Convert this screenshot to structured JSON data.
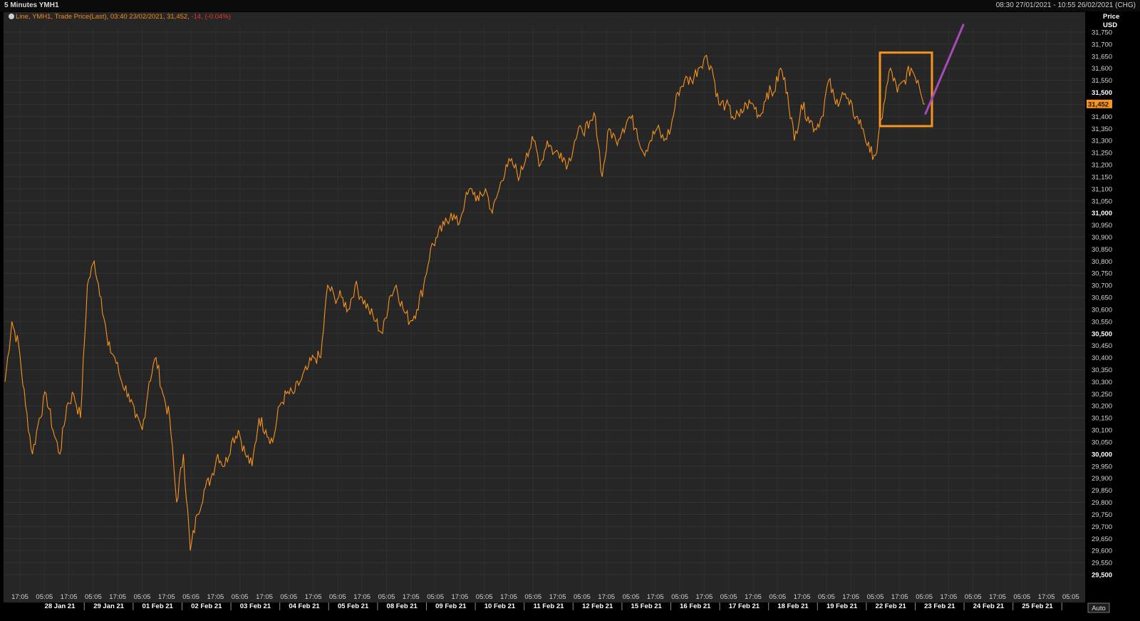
{
  "window": {
    "title": "5 Minutes YMH1",
    "date_range": "08:30 27/01/2021 - 10:55 26/02/2021 (CHG)"
  },
  "legend": {
    "series": "Line, YMH1, Trade Price(Last), 03:40 23/02/2021, 31,452,",
    "change": "-14, (-0.04%)"
  },
  "axis": {
    "price_label": "Price",
    "currency_label": "USD",
    "auto_label": "Auto",
    "last_price_label": "31,452"
  },
  "colors": {
    "background": "#262626",
    "grid": "#3a3a3a",
    "line": "#f7931e",
    "box": "#f7931e",
    "arrow": "#a64bb7",
    "last_price_tag": "#f7931e",
    "change_text": "#e8332d"
  },
  "chart_data": {
    "type": "line",
    "ylim": [
      29500,
      31800
    ],
    "ytick_values": [
      29500,
      29550,
      29600,
      29650,
      29700,
      29750,
      29800,
      29850,
      29900,
      29950,
      30000,
      30050,
      30100,
      30150,
      30200,
      30250,
      30300,
      30350,
      30400,
      30450,
      30500,
      30550,
      30600,
      30650,
      30700,
      30750,
      30800,
      30850,
      30900,
      30950,
      31000,
      31050,
      31100,
      31150,
      31200,
      31250,
      31300,
      31350,
      31400,
      31450,
      31500,
      31550,
      31600,
      31650,
      31700,
      31750
    ],
    "ytick_labels": [
      "29,500",
      "29,550",
      "29,600",
      "29,650",
      "29,700",
      "29,750",
      "29,800",
      "29,850",
      "29,900",
      "29,950",
      "30,000",
      "30,050",
      "30,100",
      "30,150",
      "30,200",
      "30,250",
      "30,300",
      "30,350",
      "30,400",
      "30,450",
      "30,500",
      "30,550",
      "30,600",
      "30,650",
      "30,700",
      "30,750",
      "30,800",
      "30,850",
      "30,900",
      "30,950",
      "31,000",
      "31,050",
      "31,100",
      "31,150",
      "31,200",
      "31,250",
      "31,300",
      "31,350",
      "31,400",
      "31,450",
      "31,500",
      "31,550",
      "31,600",
      "31,650",
      "31,700",
      "31,750"
    ],
    "ytick_major": [
      "29,500",
      "30,000",
      "30,500",
      "31,000",
      "31,500"
    ],
    "x_time_labels": [
      "17:05",
      "05:05",
      "17:05",
      "05:05",
      "17:05",
      "05:05",
      "17:05",
      "05:05",
      "17:05",
      "05:05",
      "17:05",
      "05:05",
      "17:05",
      "05:05",
      "17:05",
      "05:05",
      "17:05",
      "05:05",
      "17:05",
      "05:05",
      "17:05",
      "05:05",
      "17:05",
      "05:05",
      "17:05",
      "05:05",
      "17:05",
      "05:05",
      "17:05",
      "05:05",
      "17:05",
      "05:05",
      "17:05",
      "05:05",
      "17:05",
      "05:05",
      "17:05",
      "05:05",
      "17:05",
      "05:05",
      "17:05",
      "05:05",
      "17:05",
      "05:05"
    ],
    "x_day_labels": [
      "28 Jan 21",
      "29 Jan 21",
      "01 Feb 21",
      "02 Feb 21",
      "03 Feb 21",
      "04 Feb 21",
      "05 Feb 21",
      "08 Feb 21",
      "09 Feb 21",
      "10 Feb 21",
      "11 Feb 21",
      "12 Feb 21",
      "15 Feb 21",
      "16 Feb 21",
      "17 Feb 21",
      "18 Feb 21",
      "19 Feb 21",
      "22 Feb 21",
      "23 Feb 21",
      "24 Feb 21",
      "25 Feb 21"
    ],
    "series": [
      {
        "values": [
          30300,
          30550,
          30450,
          30200,
          30000,
          30150,
          30250,
          30100,
          30000,
          30200,
          30250,
          30150,
          30700,
          30800,
          30650,
          30450,
          30400,
          30300,
          30250,
          30150,
          30100,
          30300,
          30400,
          30250,
          30150,
          29800,
          30000,
          29600,
          29750,
          29850,
          29900,
          30000,
          29950,
          30050,
          30100,
          30000,
          29950,
          30150,
          30100,
          30050,
          30200,
          30250,
          30250,
          30300,
          30350,
          30400,
          30400,
          30700,
          30650,
          30650,
          30600,
          30700,
          30650,
          30600,
          30550,
          30500,
          30650,
          30700,
          30600,
          30550,
          30600,
          30700,
          30850,
          30900,
          30950,
          31000,
          30950,
          31050,
          31100,
          31050,
          31100,
          31000,
          31100,
          31200,
          31200,
          31150,
          31250,
          31300,
          31200,
          31300,
          31250,
          31250,
          31200,
          31300,
          31350,
          31350,
          31400,
          31150,
          31350,
          31300,
          31350,
          31400,
          31350,
          31250,
          31300,
          31350,
          31300,
          31350,
          31500,
          31550,
          31550,
          31600,
          31650,
          31600,
          31450,
          31450,
          31400,
          31400,
          31450,
          31450,
          31400,
          31500,
          31500,
          31600,
          31500,
          31300,
          31450,
          31400,
          31350,
          31400,
          31550,
          31450,
          31500,
          31450,
          31400,
          31350,
          31250,
          31250,
          31450,
          31600,
          31500,
          31550,
          31600,
          31550,
          31452
        ]
      },
      {
        "values": [
          31452,
          31600,
          31780
        ]
      }
    ]
  }
}
